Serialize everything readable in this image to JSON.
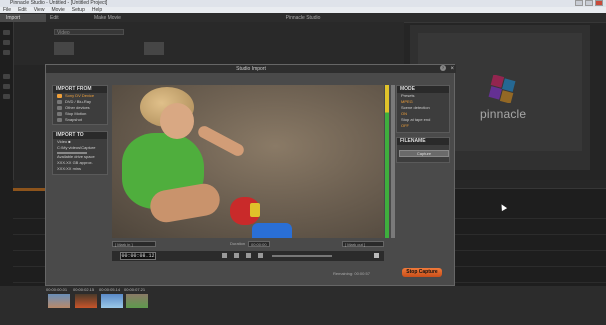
{
  "window": {
    "title": "Pinnacle Studio - Untitled - [Untitled Project]"
  },
  "menu": [
    "File",
    "Edit",
    "View",
    "Movie",
    "Setup",
    "Help"
  ],
  "app_tabs": [
    {
      "label": "Import"
    },
    {
      "label": "Edit"
    },
    {
      "label": "Make Movie"
    }
  ],
  "app_center_title": "Pinnacle Studio",
  "library": {
    "dropdown_value": "Video"
  },
  "preview": {
    "logo_text": "pinnacle"
  },
  "dialog": {
    "title": "Studio Import",
    "help_symbol": "?",
    "close_symbol": "×",
    "import_from": {
      "header": "IMPORT FROM",
      "items": [
        {
          "label": "Sony DV Device",
          "selected": true
        },
        {
          "label": "DVD / Blu-Ray",
          "selected": false
        },
        {
          "label": "Other devices",
          "selected": false
        },
        {
          "label": "Stop Motion",
          "selected": false
        },
        {
          "label": "Snapshot",
          "selected": false
        }
      ]
    },
    "import_to": {
      "header": "IMPORT TO",
      "lines": [
        "Video ■",
        "C:\\My videos\\Capture",
        "",
        "Available drive space",
        "XXX.XX GB approx. XXX:XX mins"
      ]
    },
    "mode": {
      "header": "MODE",
      "lines": [
        {
          "label": "Presets",
          "value": "MPEG"
        },
        {
          "label": "Scene detection",
          "value": "ON"
        },
        {
          "label": "Stop at tape end",
          "value": "OFF"
        }
      ]
    },
    "filename": {
      "header": "FILENAME",
      "button": "Capture"
    },
    "field_left": "[ Mark in ]",
    "duration_label": "Duration",
    "duration_value": "00:00:00",
    "field_right": "[ Mark out ]",
    "timecode": "00:00:08.12",
    "remaining_label": "Remaining: 00:00:57",
    "stop_capture": "Stop Capture"
  },
  "capture_strip": {
    "times": [
      "00:00:00.01",
      "00:00:02.15",
      "00:00:05.14",
      "00:00:07.21"
    ]
  },
  "colors": {
    "accent": "#f0a03a",
    "stop_button": "#e06a2a",
    "timeline_marker": "#d9822b"
  }
}
